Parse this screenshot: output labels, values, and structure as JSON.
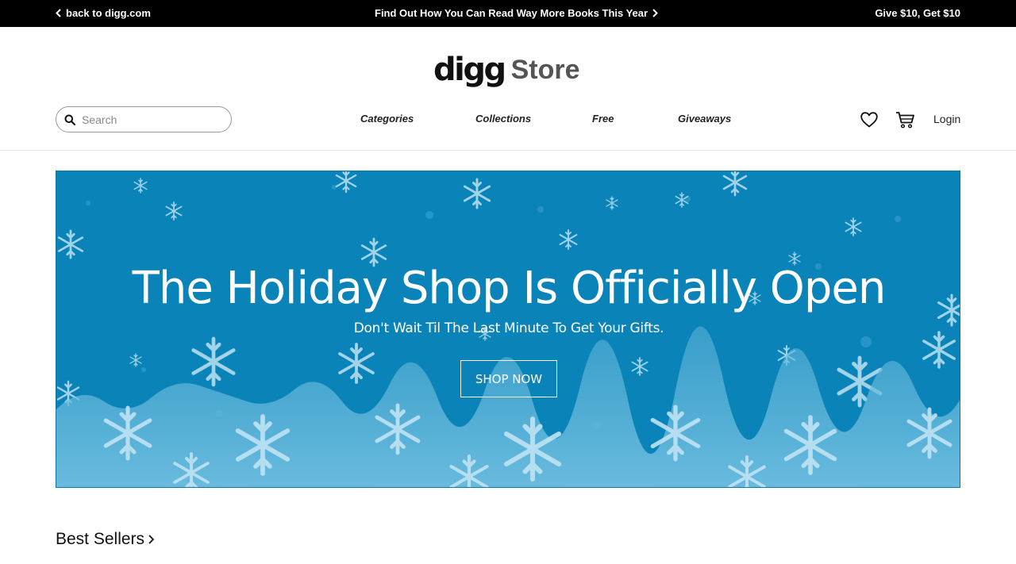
{
  "topbar": {
    "back_label": "back to digg.com",
    "promo_label": "Find Out How You Can Read Way More Books This Year",
    "give_label": "Give $10, Get $10"
  },
  "logo": {
    "brand": "digg",
    "store": "Store"
  },
  "search": {
    "placeholder": "Search"
  },
  "nav": {
    "items": [
      {
        "label": "Categories"
      },
      {
        "label": "Collections"
      },
      {
        "label": "Free"
      },
      {
        "label": "Giveaways"
      }
    ]
  },
  "account": {
    "login_label": "Login"
  },
  "hero": {
    "title": "The Holiday Shop Is Officially Open",
    "subtitle": "Don't Wait Til The Last Minute To Get Your Gifts.",
    "cta_label": "SHOP NOW",
    "bg_color": "#0a84b8"
  },
  "best_sellers": {
    "label": "Best Sellers"
  },
  "icons": {
    "heart": "heart-icon",
    "cart": "cart-icon",
    "search": "search-icon"
  }
}
